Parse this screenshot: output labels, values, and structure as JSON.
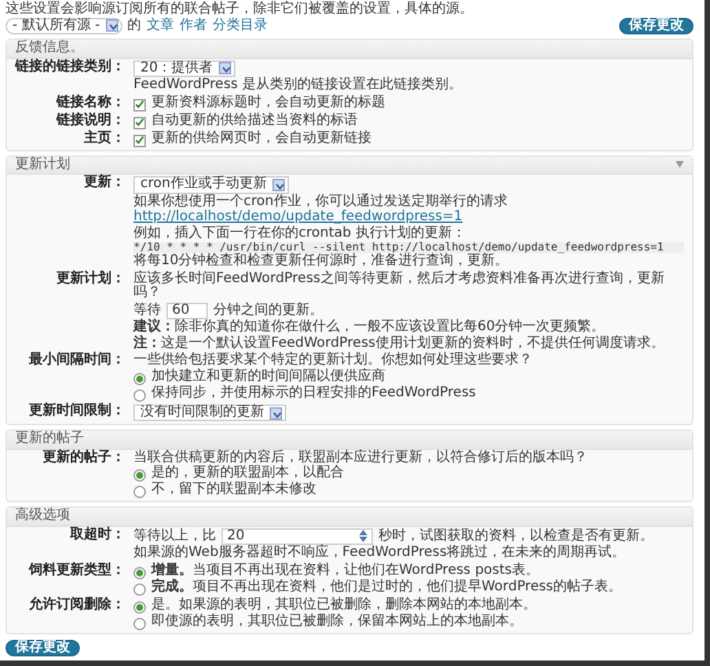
{
  "intro": "这些设置会影响源订阅所有的联合帖子，除非它们被覆盖的设置，具体的源。",
  "filter": {
    "select": "- 默认所有源 -",
    "suffix": "的",
    "links": [
      "文章",
      "作者",
      "分类目录"
    ]
  },
  "save_top": "保存更改",
  "sections": [
    {
      "title": "反馈信息。",
      "collapsible": false,
      "rows": [
        {
          "label": "链接的链接类别：",
          "items": [
            {
              "kind": "select",
              "value": "20：提供者"
            },
            {
              "kind": "note",
              "text": "FeedWordPress 是从类别的链接设置在此链接类别。"
            }
          ]
        },
        {
          "label": "链接名称：",
          "items": [
            {
              "kind": "checkbox",
              "text": "更新资料源标题时，会自动更新的标题",
              "checked": true
            }
          ]
        },
        {
          "label": "链接说明：",
          "items": [
            {
              "kind": "checkbox",
              "text": "自动更新的供给描述当资料的标语",
              "checked": true
            }
          ]
        },
        {
          "label": "主页：",
          "items": [
            {
              "kind": "checkbox",
              "text": "更新的供给网页时，会自动更新链接",
              "checked": true
            }
          ]
        }
      ]
    },
    {
      "title": "更新计划",
      "collapsible": true,
      "rows": [
        {
          "label": "更新：",
          "items": [
            {
              "kind": "select",
              "value": "cron作业或手动更新"
            },
            {
              "kind": "linked",
              "before": "如果你想使用一个cron作业，你可以通过发送定期举行的请求",
              "link": "http://localhost/demo/update_feedwordpress=1",
              "after": "例如，插入下面一行在你的crontab 执行计划的更新："
            },
            {
              "kind": "code",
              "text": "*/10 * * * * /usr/bin/curl --silent http://localhost/demo/update_feedwordpress=1"
            },
            {
              "kind": "note",
              "text": "将每10分钟检查和检查更新任何源时，准备进行查询，更新。"
            }
          ]
        },
        {
          "label": "更新计划：",
          "items": [
            {
              "kind": "note",
              "text": "应该多长时间FeedWordPress之间等待更新，然后才考虑资料准备再次进行查询，更新吗？"
            },
            {
              "kind": "inline_input",
              "before": "等待",
              "value": "60",
              "after": "分钟之间的更新。"
            },
            {
              "kind": "note",
              "text": "**建议：**除非你真的知道你在做什么，一般不应该设置比每60分钟一次更频繁。"
            },
            {
              "kind": "note",
              "text": "**注：**这是一个默认设置FeedWordPress使用计划更新的资料时，不提供任何调度请求。"
            }
          ]
        },
        {
          "label": "最小间隔时间：",
          "items": [
            {
              "kind": "note",
              "text": "一些供给包括要求某个特定的更新计划。你想如何处理这些要求？"
            },
            {
              "kind": "radio",
              "text": "加快建立和更新的时间间隔以便供应商",
              "selected": true
            },
            {
              "kind": "radio",
              "text": "保持同步，并使用标示的日程安排的FeedWordPress",
              "selected": false
            }
          ]
        },
        {
          "label": "更新时间限制：",
          "items": [
            {
              "kind": "select",
              "value": "没有时间限制的更新"
            }
          ]
        }
      ]
    },
    {
      "title": "更新的帖子",
      "collapsible": false,
      "rows": [
        {
          "label": "更新的帖子：",
          "items": [
            {
              "kind": "note",
              "text": "当联合供稿更新的内容后，联盟副本应进行更新，以符合修订后的版本吗？"
            },
            {
              "kind": "radio",
              "text": "是的，更新的联盟副本，以配合",
              "selected": true
            },
            {
              "kind": "radio",
              "text": "不，留下的联盟副本未修改",
              "selected": false
            }
          ]
        }
      ]
    },
    {
      "title": "高级选项",
      "collapsible": false,
      "rows": [
        {
          "label": "取超时：",
          "items": [
            {
              "kind": "spin_input",
              "before": "等待以上，比",
              "value": "20",
              "after": "秒时，试图获取的资料，以检查是否有更新。"
            },
            {
              "kind": "note",
              "text": "如果源的Web服务器超时不响应，FeedWordPress将跳过，在未来的周期再试。"
            }
          ]
        },
        {
          "label": "饲料更新类型：",
          "items": [
            {
              "kind": "radio",
              "text": "**增量。**当项目不再出现在资料，让他们在WordPress posts表。",
              "selected": true
            },
            {
              "kind": "radio",
              "text": "**完成。**项目不再出现在资料，他们是过时的，他们提早WordPress的帖子表。",
              "selected": false
            }
          ]
        },
        {
          "label": "允许订阅删除：",
          "items": [
            {
              "kind": "radio",
              "text": "是。如果源的表明，其职位已被删除，删除本网站的本地副本。",
              "selected": true
            },
            {
              "kind": "radio",
              "text": "即使源的表明，其职位已被删除，保留本网站上的本地副本。",
              "selected": false
            }
          ]
        }
      ]
    }
  ],
  "save_bottom": "保存更改"
}
